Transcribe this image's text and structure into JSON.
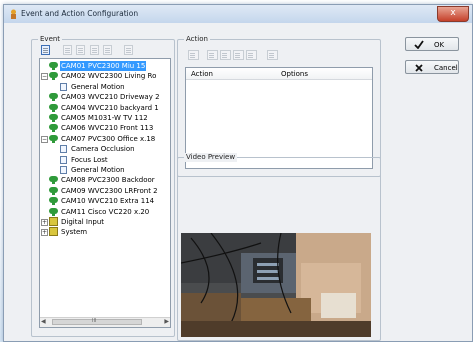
{
  "window": {
    "title": "Event and Action Configuration",
    "close_glyph": "x",
    "accent": "#3399ff"
  },
  "event_panel": {
    "label": "Event",
    "toolbar_icons": [
      "new-event-icon",
      "edit-icon",
      "copy-icon",
      "delete-icon",
      "properties-icon"
    ],
    "tree": [
      {
        "kind": "camera",
        "label": "CAM01 PVC2300 Miu 15",
        "selected": true
      },
      {
        "kind": "camera",
        "label": "CAM02 WVC2300 Living Ro",
        "expanded": true
      },
      {
        "kind": "event",
        "label": "General Motion"
      },
      {
        "kind": "camera",
        "label": "CAM03 WVC210 Driveway 2"
      },
      {
        "kind": "camera",
        "label": "CAM04 WVC210 backyard 1"
      },
      {
        "kind": "camera",
        "label": "CAM05 M1031-W TV 112"
      },
      {
        "kind": "camera",
        "label": "CAM06 WVC210 Front 113"
      },
      {
        "kind": "camera",
        "label": "CAM07 PVC300 Office x.18",
        "expanded": true
      },
      {
        "kind": "event",
        "label": "Camera Occlusion"
      },
      {
        "kind": "event",
        "label": "Focus Lost"
      },
      {
        "kind": "event",
        "label": "General Motion"
      },
      {
        "kind": "camera",
        "label": "CAM08 PVC2300 Backdoor"
      },
      {
        "kind": "camera",
        "label": "CAM09 WVC2300 LRFront 2"
      },
      {
        "kind": "camera",
        "label": "CAM10 WVC210 Extra 114"
      },
      {
        "kind": "camera",
        "label": "CAM11 Cisco VC220 x.20"
      },
      {
        "kind": "io",
        "label": "Digital Input"
      },
      {
        "kind": "io",
        "label": "System"
      }
    ],
    "scroll_grip": "III"
  },
  "action_panel": {
    "label": "Action",
    "toolbar_icons": [
      "add-action-icon",
      "edit-action-icon",
      "copy-action-icon",
      "delete-action-icon",
      "move-action-icon",
      "test-action-icon"
    ],
    "columns": [
      "Action",
      "Options"
    ]
  },
  "preview_panel": {
    "label": "Video Preview"
  },
  "buttons": {
    "ok": "OK",
    "cancel": "Cancel"
  }
}
